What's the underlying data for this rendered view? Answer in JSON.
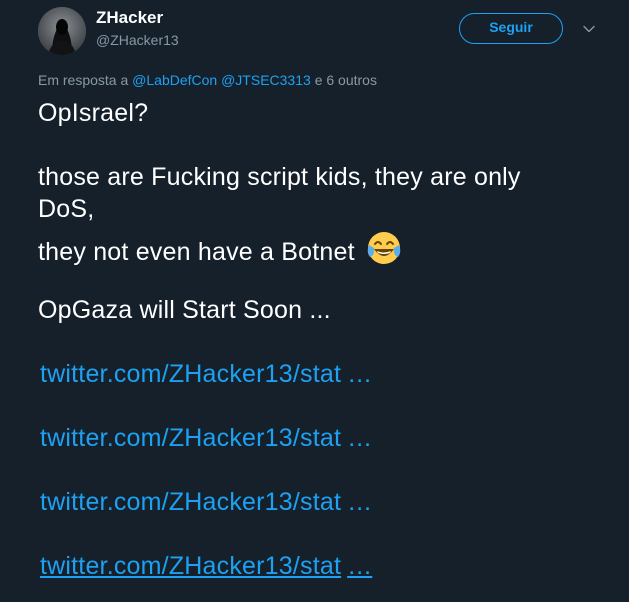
{
  "author": {
    "display_name": "ZHacker",
    "handle": "@ZHacker13"
  },
  "follow_button_label": "Seguir",
  "reply": {
    "prefix": "Em resposta a",
    "mentions": [
      "@LabDefCon",
      "@JTSEC3313"
    ],
    "suffix": "e 6 outros"
  },
  "tweet": {
    "line1": "OpIsrael?",
    "line2": "those are Fucking script kids, they are only",
    "line3": "DoS,",
    "line4": "they not even have a Botnet",
    "line4_emoji": "face-with-tears-of-joy-emoji",
    "line5": "OpGaza will Start Soon ...",
    "links": [
      {
        "url": "twitter.com/ZHacker13/stat",
        "ellipsis": "…"
      },
      {
        "url": "twitter.com/ZHacker13/stat",
        "ellipsis": "…"
      },
      {
        "url": "twitter.com/ZHacker13/stat",
        "ellipsis": "…"
      },
      {
        "url": "twitter.com/ZHacker13/stat",
        "ellipsis": "…"
      }
    ]
  },
  "colors": {
    "background": "#15202b",
    "accent": "#1da1f2",
    "secondary_text": "#8899a6"
  }
}
